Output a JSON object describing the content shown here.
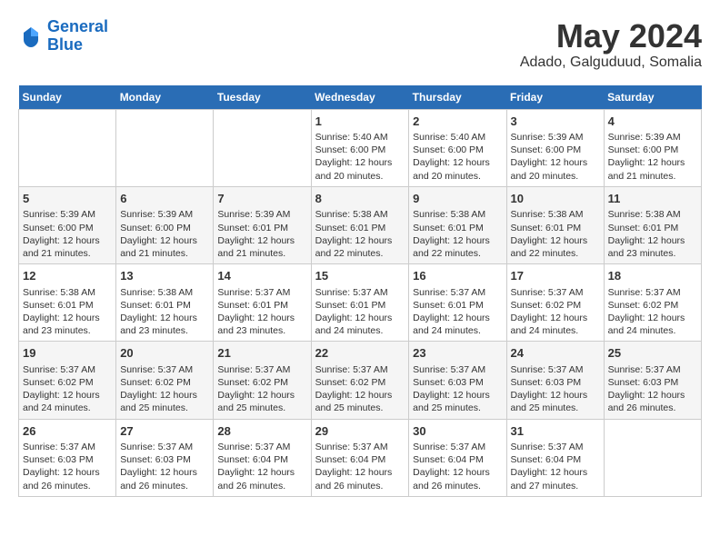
{
  "header": {
    "logo_line1": "General",
    "logo_line2": "Blue",
    "month": "May 2024",
    "location": "Adado, Galguduud, Somalia"
  },
  "days_of_week": [
    "Sunday",
    "Monday",
    "Tuesday",
    "Wednesday",
    "Thursday",
    "Friday",
    "Saturday"
  ],
  "weeks": [
    [
      {
        "day": "",
        "info": ""
      },
      {
        "day": "",
        "info": ""
      },
      {
        "day": "",
        "info": ""
      },
      {
        "day": "1",
        "info": "Sunrise: 5:40 AM\nSunset: 6:00 PM\nDaylight: 12 hours and 20 minutes."
      },
      {
        "day": "2",
        "info": "Sunrise: 5:40 AM\nSunset: 6:00 PM\nDaylight: 12 hours and 20 minutes."
      },
      {
        "day": "3",
        "info": "Sunrise: 5:39 AM\nSunset: 6:00 PM\nDaylight: 12 hours and 20 minutes."
      },
      {
        "day": "4",
        "info": "Sunrise: 5:39 AM\nSunset: 6:00 PM\nDaylight: 12 hours and 21 minutes."
      }
    ],
    [
      {
        "day": "5",
        "info": "Sunrise: 5:39 AM\nSunset: 6:00 PM\nDaylight: 12 hours and 21 minutes."
      },
      {
        "day": "6",
        "info": "Sunrise: 5:39 AM\nSunset: 6:00 PM\nDaylight: 12 hours and 21 minutes."
      },
      {
        "day": "7",
        "info": "Sunrise: 5:39 AM\nSunset: 6:01 PM\nDaylight: 12 hours and 21 minutes."
      },
      {
        "day": "8",
        "info": "Sunrise: 5:38 AM\nSunset: 6:01 PM\nDaylight: 12 hours and 22 minutes."
      },
      {
        "day": "9",
        "info": "Sunrise: 5:38 AM\nSunset: 6:01 PM\nDaylight: 12 hours and 22 minutes."
      },
      {
        "day": "10",
        "info": "Sunrise: 5:38 AM\nSunset: 6:01 PM\nDaylight: 12 hours and 22 minutes."
      },
      {
        "day": "11",
        "info": "Sunrise: 5:38 AM\nSunset: 6:01 PM\nDaylight: 12 hours and 23 minutes."
      }
    ],
    [
      {
        "day": "12",
        "info": "Sunrise: 5:38 AM\nSunset: 6:01 PM\nDaylight: 12 hours and 23 minutes."
      },
      {
        "day": "13",
        "info": "Sunrise: 5:38 AM\nSunset: 6:01 PM\nDaylight: 12 hours and 23 minutes."
      },
      {
        "day": "14",
        "info": "Sunrise: 5:37 AM\nSunset: 6:01 PM\nDaylight: 12 hours and 23 minutes."
      },
      {
        "day": "15",
        "info": "Sunrise: 5:37 AM\nSunset: 6:01 PM\nDaylight: 12 hours and 24 minutes."
      },
      {
        "day": "16",
        "info": "Sunrise: 5:37 AM\nSunset: 6:01 PM\nDaylight: 12 hours and 24 minutes."
      },
      {
        "day": "17",
        "info": "Sunrise: 5:37 AM\nSunset: 6:02 PM\nDaylight: 12 hours and 24 minutes."
      },
      {
        "day": "18",
        "info": "Sunrise: 5:37 AM\nSunset: 6:02 PM\nDaylight: 12 hours and 24 minutes."
      }
    ],
    [
      {
        "day": "19",
        "info": "Sunrise: 5:37 AM\nSunset: 6:02 PM\nDaylight: 12 hours and 24 minutes."
      },
      {
        "day": "20",
        "info": "Sunrise: 5:37 AM\nSunset: 6:02 PM\nDaylight: 12 hours and 25 minutes."
      },
      {
        "day": "21",
        "info": "Sunrise: 5:37 AM\nSunset: 6:02 PM\nDaylight: 12 hours and 25 minutes."
      },
      {
        "day": "22",
        "info": "Sunrise: 5:37 AM\nSunset: 6:02 PM\nDaylight: 12 hours and 25 minutes."
      },
      {
        "day": "23",
        "info": "Sunrise: 5:37 AM\nSunset: 6:03 PM\nDaylight: 12 hours and 25 minutes."
      },
      {
        "day": "24",
        "info": "Sunrise: 5:37 AM\nSunset: 6:03 PM\nDaylight: 12 hours and 25 minutes."
      },
      {
        "day": "25",
        "info": "Sunrise: 5:37 AM\nSunset: 6:03 PM\nDaylight: 12 hours and 26 minutes."
      }
    ],
    [
      {
        "day": "26",
        "info": "Sunrise: 5:37 AM\nSunset: 6:03 PM\nDaylight: 12 hours and 26 minutes."
      },
      {
        "day": "27",
        "info": "Sunrise: 5:37 AM\nSunset: 6:03 PM\nDaylight: 12 hours and 26 minutes."
      },
      {
        "day": "28",
        "info": "Sunrise: 5:37 AM\nSunset: 6:04 PM\nDaylight: 12 hours and 26 minutes."
      },
      {
        "day": "29",
        "info": "Sunrise: 5:37 AM\nSunset: 6:04 PM\nDaylight: 12 hours and 26 minutes."
      },
      {
        "day": "30",
        "info": "Sunrise: 5:37 AM\nSunset: 6:04 PM\nDaylight: 12 hours and 26 minutes."
      },
      {
        "day": "31",
        "info": "Sunrise: 5:37 AM\nSunset: 6:04 PM\nDaylight: 12 hours and 27 minutes."
      },
      {
        "day": "",
        "info": ""
      }
    ]
  ]
}
